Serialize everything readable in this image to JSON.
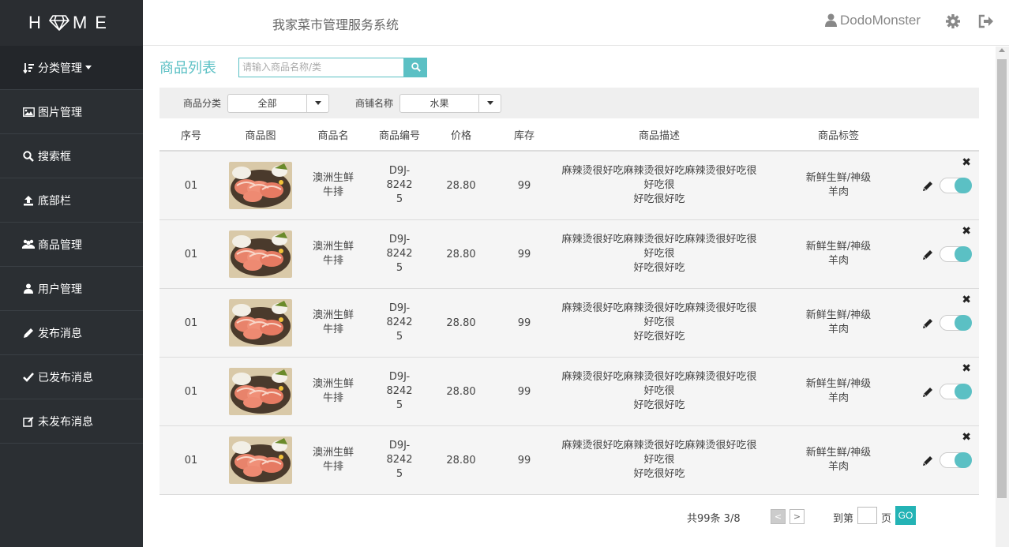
{
  "brand": {
    "left": "H",
    "right": "ME"
  },
  "header": {
    "system_title": "我家菜市管理服务系统",
    "username": "DodoMonster"
  },
  "sidebar": {
    "items": [
      {
        "label": "分类管理",
        "icon": "sort-icon"
      },
      {
        "label": "图片管理",
        "icon": "image-icon"
      },
      {
        "label": "搜索框",
        "icon": "search-icon"
      },
      {
        "label": "底部栏",
        "icon": "upload-icon"
      },
      {
        "label": "商品管理",
        "icon": "users-icon"
      },
      {
        "label": "用户管理",
        "icon": "user-icon"
      },
      {
        "label": "发布消息",
        "icon": "pencil-icon"
      },
      {
        "label": "已发布消息",
        "icon": "check-icon"
      },
      {
        "label": "未发布消息",
        "icon": "edit-icon"
      }
    ]
  },
  "main": {
    "title": "商品列表",
    "search_placeholder": "请输入商品名称/类",
    "filters": {
      "category_label": "商品分类",
      "category_value": "全部",
      "shop_label": "商铺名称",
      "shop_value": "水果"
    },
    "columns": [
      "序号",
      "商品图",
      "商品名",
      "商品编号",
      "价格",
      "库存",
      "商品描述",
      "商品标签"
    ],
    "rows": [
      {
        "index": "01",
        "name": "澳洲生鲜牛排",
        "code": "D9J-82425",
        "price": "28.80",
        "stock": "99",
        "desc": "麻辣烫很好吃麻辣烫很好吃麻辣烫很好吃很好吃很好吃很好吃",
        "tag": "新鲜生鲜/神级羊肉",
        "enabled": true
      },
      {
        "index": "01",
        "name": "澳洲生鲜牛排",
        "code": "D9J-82425",
        "price": "28.80",
        "stock": "99",
        "desc": "麻辣烫很好吃麻辣烫很好吃麻辣烫很好吃很好吃很好吃很好吃",
        "tag": "新鲜生鲜/神级羊肉",
        "enabled": true
      },
      {
        "index": "01",
        "name": "澳洲生鲜牛排",
        "code": "D9J-82425",
        "price": "28.80",
        "stock": "99",
        "desc": "麻辣烫很好吃麻辣烫很好吃麻辣烫很好吃很好吃很好吃很好吃",
        "tag": "新鲜生鲜/神级羊肉",
        "enabled": true
      },
      {
        "index": "01",
        "name": "澳洲生鲜牛排",
        "code": "D9J-82425",
        "price": "28.80",
        "stock": "99",
        "desc": "麻辣烫很好吃麻辣烫很好吃麻辣烫很好吃很好吃很好吃很好吃",
        "tag": "新鲜生鲜/神级羊肉",
        "enabled": true
      },
      {
        "index": "01",
        "name": "澳洲生鲜牛排",
        "code": "D9J-82425",
        "price": "28.80",
        "stock": "99",
        "desc": "麻辣烫很好吃麻辣烫很好吃麻辣烫很好吃很好吃很好吃很好吃",
        "tag": "新鲜生鲜/神级羊肉",
        "enabled": true
      }
    ]
  },
  "pagination": {
    "total_text": "共99条 3/8",
    "prev": "<",
    "next": ">",
    "goto_label": "到第",
    "page_label": "页",
    "go_label": "GO"
  },
  "colors": {
    "accent": "#5bc0c4",
    "sidebar_bg": "#2b2f33",
    "go_button": "#24b3b5"
  }
}
